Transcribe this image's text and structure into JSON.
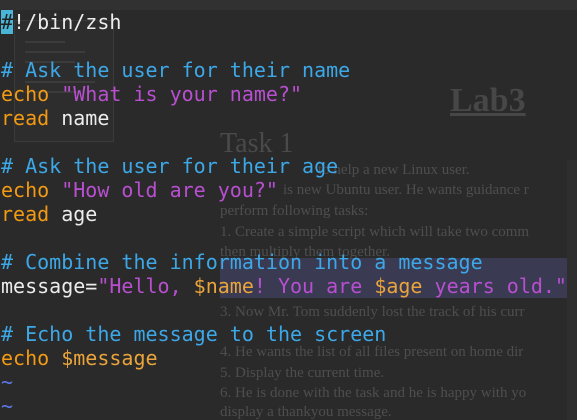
{
  "background_document": {
    "heading": "Lab3",
    "task_heading": "Task 1",
    "lines": [
      "to help a new Linux user.",
      "is new Ubuntu user. He wants guidance r",
      "perform following tasks:",
      "1. Create a simple script which will take two comm",
      "then multiply them together.",
      "3. Now Mr. Tom suddenly lost the track of his curr",
      "4. He wants the list of all files present on home dir",
      "5. Display the current time.",
      "6. He is done with the task and he is happy with yo",
      "display a thankyou message."
    ]
  },
  "editor": {
    "cursor_char": "#",
    "shebang_rest": "!/bin/zsh",
    "comment_ask_name": "# Ask the user for their name",
    "echo_kw_1": "echo",
    "echo_str_1": "\"What is your name?\"",
    "read_kw_1": "read",
    "read_var_1": "name",
    "comment_ask_age": "# Ask the user for their age",
    "echo_kw_2": "echo",
    "echo_str_2": "\"How old are you?\"",
    "read_kw_2": "read",
    "read_var_2": "age",
    "comment_combine": "# Combine the information into a message",
    "assign_var": "message",
    "assign_eq": "=",
    "assign_str_a": "\"Hello, ",
    "assign_ref_name": "$name",
    "assign_str_b": "! You are ",
    "assign_ref_age": "$age",
    "assign_str_c": " years old.\"",
    "comment_echo": "# Echo the message to the screen",
    "echo_kw_3": "echo",
    "echo_ref": "$message",
    "tilde_1": "~",
    "tilde_2": "~"
  },
  "colors": {
    "comment": "#3da8e8",
    "keyword": "#f29a14",
    "string": "#b84fd0",
    "variable": "#e9a43c",
    "plain": "#ececec",
    "tilde": "#5a78e8",
    "cursor": "#4ab5d6"
  }
}
